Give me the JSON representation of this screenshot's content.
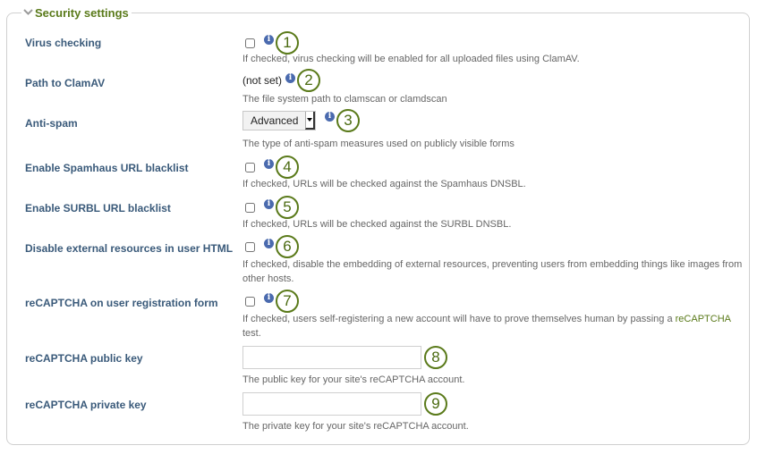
{
  "fieldset": {
    "legend": "Security settings",
    "legend_icon": "chevron-down-icon"
  },
  "colors": {
    "accent_green": "#5a7a1a",
    "label_blue": "#3a5a7a",
    "info_blue": "#4a6aae",
    "desc_gray": "#666666"
  },
  "settings": [
    {
      "label": "Virus checking",
      "type": "checkbox",
      "checked": false,
      "callout": "1",
      "description": "If checked, virus checking will be enabled for all uploaded files using ClamAV."
    },
    {
      "label": "Path to ClamAV",
      "type": "static",
      "value": "(not set)",
      "callout": "2",
      "description": "The file system path to clamscan or clamdscan"
    },
    {
      "label": "Anti-spam",
      "type": "select",
      "value": "Advanced",
      "callout": "3",
      "description": "The type of anti-spam measures used on publicly visible forms"
    },
    {
      "label": "Enable Spamhaus URL blacklist",
      "type": "checkbox",
      "checked": false,
      "callout": "4",
      "description": "If checked, URLs will be checked against the Spamhaus DNSBL."
    },
    {
      "label": "Enable SURBL URL blacklist",
      "type": "checkbox",
      "checked": false,
      "callout": "5",
      "description": "If checked, URLs will be checked against the SURBL DNSBL."
    },
    {
      "label": "Disable external resources in user HTML",
      "type": "checkbox",
      "checked": false,
      "callout": "6",
      "description": "If checked, disable the embedding of external resources, preventing users from embedding things like images from other hosts."
    },
    {
      "label": "reCAPTCHA on user registration form",
      "type": "checkbox",
      "checked": false,
      "callout": "7",
      "description_prefix": "If checked, users self-registering a new account will have to prove themselves human by passing a ",
      "description_link": "reCAPTCHA",
      "description_suffix": " test."
    },
    {
      "label": "reCAPTCHA public key",
      "type": "text",
      "value": "",
      "placeholder": "",
      "callout": "8",
      "description": "The public key for your site's reCAPTCHA account."
    },
    {
      "label": "reCAPTCHA private key",
      "type": "text",
      "value": "",
      "placeholder": "",
      "callout": "9",
      "description": "The private key for your site's reCAPTCHA account."
    }
  ],
  "info_icon_glyph": "i"
}
